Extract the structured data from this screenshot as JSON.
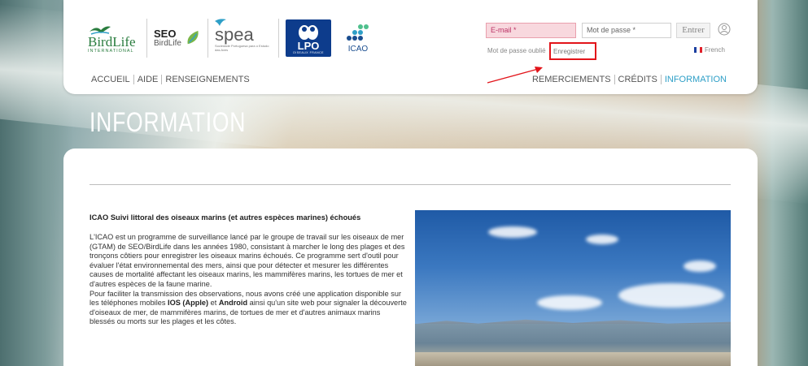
{
  "header": {
    "logos": {
      "birdlife_name": "BirdLife",
      "birdlife_sub": "INTERNATIONAL",
      "seo_big": "SEO",
      "seo_small": "BirdLife",
      "spea_name": "spea",
      "spea_sub": "Sociedade Portuguesa para o Estudo das Aves",
      "lpo_name": "LPO",
      "lpo_sub": "OISEAUX FRANCE",
      "icao_name": "ICAO"
    },
    "login": {
      "email_placeholder": "E-mail *",
      "password_placeholder": "Mot de passe *",
      "enter_label": "Entrer",
      "forgot_password": "Mot de passe oublié",
      "register": "Enregistrer",
      "language": "French"
    },
    "nav_left": [
      "ACCUEIL",
      "AIDE",
      "RENSEIGNEMENTS"
    ],
    "nav_right": [
      "REMERCIEMENTS",
      "CRÉDITS",
      "INFORMATION"
    ]
  },
  "page_title": "INFORMATION",
  "article": {
    "title": "ICAO  Suivi littoral des oiseaux marins (et autres espèces marines) échoués",
    "para1": "L'ICAO est un programme de surveillance lancé par le groupe de travail sur les oiseaux de mer (GTAM) de SEO/BirdLife dans les années 1980, consistant à marcher le long des plages et des tronçons côtiers pour enregistrer les oiseaux marins échoués. Ce programme sert d'outil pour évaluer l'état environnemental des mers, ainsi que pour détecter et mesurer les différentes causes de mortalité affectant les oiseaux marins, les mammifères marins, les tortues de mer et d'autres espèces de la faune marine.",
    "para2_a": "Pour faciliter la transmission des observations, nous avons créé une application disponible sur les téléphones mobiles ",
    "para2_ios": "IOS (Apple)",
    "para2_b": " et ",
    "para2_android": "Android",
    "para2_c": " ainsi qu'un site web pour signaler la découverte d'oiseaux de mer, de mammifères marins, de tortues de mer et d'autres animaux marins blessés ou morts sur les plages et les côtes."
  },
  "colors": {
    "accent": "#2e9fc7",
    "highlight_box": "#e2141a",
    "lpo_blue": "#0d3c8c",
    "birdlife_green": "#2a7d3f"
  },
  "icons": {
    "user": "user-circle-icon",
    "flag": "flag-france-icon"
  }
}
